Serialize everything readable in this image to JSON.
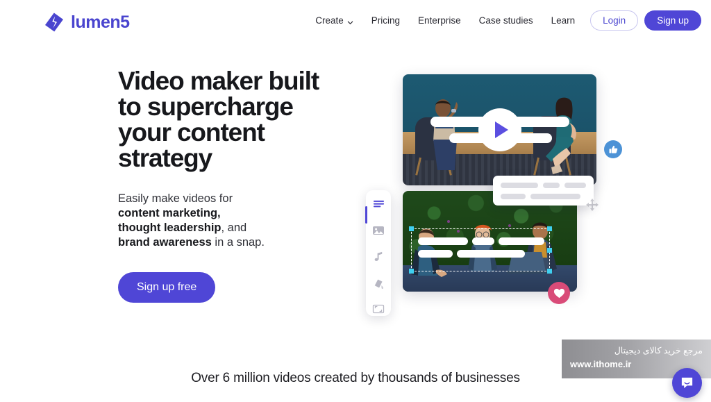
{
  "header": {
    "brand": {
      "name": "lumen5",
      "logo_icon": "lumen5-diamond-logo",
      "color": "#4a45cf"
    },
    "nav": [
      {
        "label": "Create",
        "has_dropdown": true,
        "icon": "chevron-down-icon"
      },
      {
        "label": "Pricing",
        "has_dropdown": false
      },
      {
        "label": "Enterprise",
        "has_dropdown": false
      },
      {
        "label": "Case studies",
        "has_dropdown": false
      },
      {
        "label": "Learn",
        "has_dropdown": false
      }
    ],
    "login_label": "Login",
    "signup_label": "Sign up"
  },
  "hero": {
    "headline": "Video maker built to supercharge your content strategy",
    "subcopy": {
      "line1": "Easily make videos for",
      "bold1": "content marketing,",
      "bold2": "thought leadership",
      "mid": ", and",
      "bold3": "brand awareness",
      "tail": " in a snap."
    },
    "cta_label": "Sign up free"
  },
  "visual": {
    "top_card": {
      "name": "video-preview-interview",
      "play_icon": "play-triangle-icon",
      "description": "Two people seated in armchairs against a teal wall"
    },
    "bottom_card": {
      "name": "video-preview-outdoor-meeting",
      "description": "Three people at a table in front of a green hedge",
      "selected": true
    },
    "toolbar": [
      {
        "icon": "text-lines-icon",
        "label": "Text",
        "active": true
      },
      {
        "icon": "image-icon",
        "label": "Media",
        "active": false
      },
      {
        "icon": "music-note-icon",
        "label": "Audio",
        "active": false
      },
      {
        "icon": "paint-bucket-icon",
        "label": "Brand",
        "active": false
      },
      {
        "icon": "crop-frame-icon",
        "label": "Format",
        "active": false
      }
    ],
    "badges": [
      {
        "icon": "thumbs-up-icon",
        "color": "#4c92d6"
      },
      {
        "icon": "heart-icon",
        "color": "#d94b78"
      }
    ],
    "move_icon": "move-arrows-icon"
  },
  "footer": {
    "tagline": "Over 6 million videos created by thousands of businesses"
  },
  "watermark": {
    "text_fa": "مرجع خرید کالای دیجیتال",
    "url": "www.ithome.ir"
  },
  "chat": {
    "icon": "chat-bubble-icon",
    "color": "#4f46d6"
  }
}
